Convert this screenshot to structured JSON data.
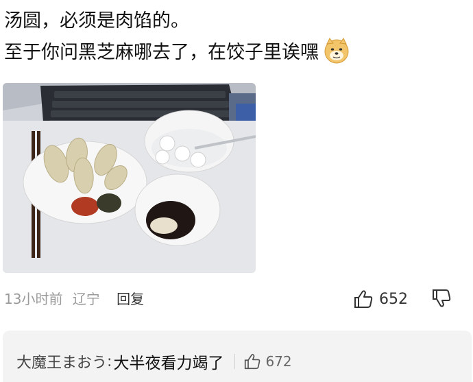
{
  "comment": {
    "line1": "汤圆，必须是肉馅的。",
    "line2": "至于你问黑芝麻哪去了，在饺子里诶嘿",
    "emoji": "doge-emoji"
  },
  "meta": {
    "time": "13小时前",
    "location": "辽宁",
    "reply_label": "回复"
  },
  "actions": {
    "like_count": "652"
  },
  "reply": {
    "author": "大魔王まおう",
    "separator": ":",
    "content": "大半夜看力竭了",
    "like_count": "672"
  },
  "icons": {
    "like": "thumbs-up-icon",
    "dislike": "thumbs-down-icon"
  }
}
